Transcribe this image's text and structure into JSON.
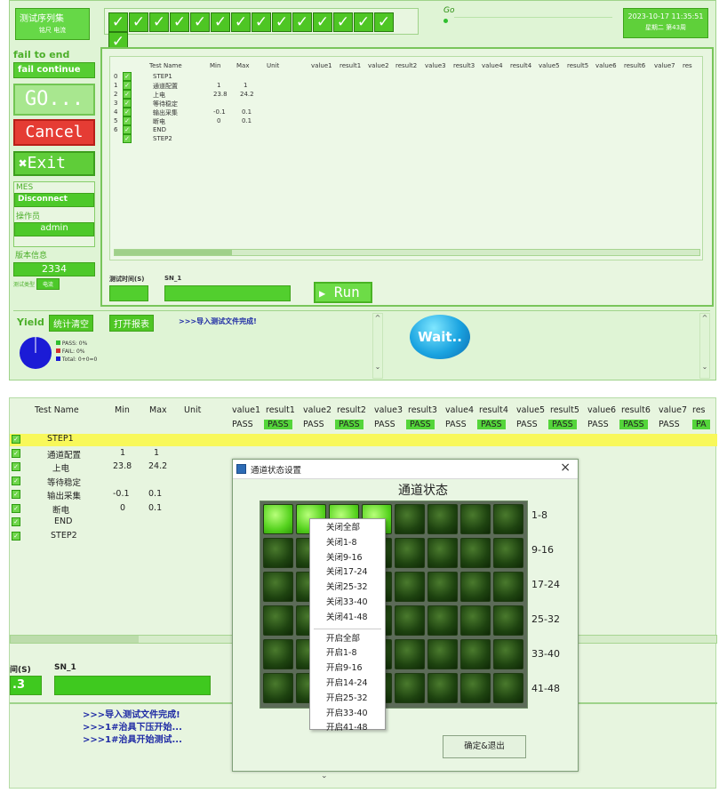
{
  "top": {
    "seq_title": "测试序列集",
    "seq_sub": "铭尺 电流",
    "go_label": "Go",
    "datetime": "2023-10-17 11:35:51",
    "weekday": "星期二 第43周",
    "fail_to_end": "fail to end",
    "fail_continue": "fail continue",
    "go_button": "GO...",
    "cancel_button": "Cancel",
    "exit_button": "Exit",
    "mes_label": "MES",
    "disconnect": "Disconnect",
    "operator_label": "操作员",
    "operator_value": "admin",
    "version_label": "版本信息",
    "version_value": "2334",
    "test_type_label": "测试类型",
    "test_type_value": "电流",
    "table_headers": [
      "Test Name",
      "Min",
      "Max",
      "Unit",
      "value1",
      "result1",
      "value2",
      "result2",
      "value3",
      "result3",
      "value4",
      "result4",
      "value5",
      "result5",
      "value6",
      "result6",
      "value7",
      "res"
    ],
    "rows": [
      {
        "idx": "0",
        "name": "STEP1",
        "min": "",
        "max": ""
      },
      {
        "idx": "1",
        "name": "通道配置",
        "min": "1",
        "max": "1"
      },
      {
        "idx": "2",
        "name": "上电",
        "min": "23.8",
        "max": "24.2"
      },
      {
        "idx": "3",
        "name": "等待稳定",
        "min": "",
        "max": ""
      },
      {
        "idx": "4",
        "name": "输出采集",
        "min": "-0.1",
        "max": "0.1"
      },
      {
        "idx": "5",
        "name": "断电",
        "min": "0",
        "max": "0.1"
      },
      {
        "idx": "6",
        "name": "END",
        "min": "",
        "max": ""
      },
      {
        "idx": "",
        "name": "STEP2",
        "min": "",
        "max": ""
      }
    ],
    "test_time_label": "测试时间(S)",
    "sn_label": "SN_1",
    "run_button": "Run",
    "yield_label": "Yield",
    "stat_clear": "统计清空",
    "open_report": "打开报表",
    "log_line": ">>>导入测试文件完成!",
    "pass_legend": "PASS: 0%",
    "fail_legend": "FAIL: 0%",
    "total_legend": "Total: 0+0=0",
    "wait_button": "Wait..",
    "colors": {
      "pass": "#2fbf2f",
      "fail": "#d32f2f",
      "total": "#1b1bd6"
    }
  },
  "bottom": {
    "table_headers": [
      "Test Name",
      "Min",
      "Max",
      "Unit",
      "value1",
      "result1",
      "value2",
      "result2",
      "value3",
      "result3",
      "value4",
      "result4",
      "value5",
      "result5",
      "value6",
      "result6",
      "value7",
      "res"
    ],
    "result_row": [
      "PASS",
      "PASS",
      "PASS",
      "PASS",
      "PASS",
      "PASS",
      "PASS",
      "PASS",
      "PASS",
      "PASS",
      "PASS",
      "PASS",
      "PASS",
      "PA"
    ],
    "rows": [
      {
        "name": "STEP1",
        "min": "",
        "max": ""
      },
      {
        "name": "通道配置",
        "min": "1",
        "max": "1"
      },
      {
        "name": "上电",
        "min": "23.8",
        "max": "24.2"
      },
      {
        "name": "等待稳定",
        "min": "",
        "max": ""
      },
      {
        "name": "输出采集",
        "min": "-0.1",
        "max": "0.1"
      },
      {
        "name": "断电",
        "min": "0",
        "max": "0.1"
      },
      {
        "name": "END",
        "min": "",
        "max": ""
      },
      {
        "name": "STEP2",
        "min": "",
        "max": ""
      }
    ],
    "time_label": "间(S)",
    "sn_label": "SN_1",
    "time_value": ".3",
    "log_lines": [
      ">>>导入测试文件完成!",
      ">>>1#治具下压开始...",
      ">>>1#治具开始测试..."
    ],
    "dialog": {
      "title": "通道状态设置",
      "close": "×",
      "heading": "通道状态",
      "row_labels": [
        "1-8",
        "9-16",
        "17-24",
        "25-32",
        "33-40",
        "41-48"
      ],
      "confirm_button": "确定&退出"
    },
    "menu_items_close": [
      "关闭全部",
      "关闭1-8",
      "关闭9-16",
      "关闭17-24",
      "关闭25-32",
      "关闭33-40",
      "关闭41-48"
    ],
    "menu_items_open": [
      "开启全部",
      "开启1-8",
      "开启9-16",
      "开启14-24",
      "开启25-32",
      "开启33-40",
      "开启41-48"
    ]
  }
}
